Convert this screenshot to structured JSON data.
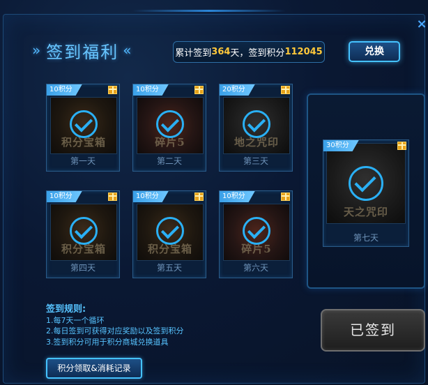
{
  "header": {
    "title": "签到福利",
    "title_deco_left": "»",
    "title_deco_right": "«",
    "stats_prefix": "累计签到",
    "total_days": "364",
    "stats_mid": "天，签到积分",
    "total_points": "112045",
    "exchange_label": "兑换",
    "close_glyph": "×"
  },
  "days": [
    {
      "label": "第一天",
      "points": "10积分",
      "item_text": "积分宝箱",
      "signed": true
    },
    {
      "label": "第二天",
      "points": "10积分",
      "item_text": "碎片5",
      "signed": true
    },
    {
      "label": "第三天",
      "points": "20积分",
      "item_text": "地之咒印",
      "signed": true
    },
    {
      "label": "第四天",
      "points": "10积分",
      "item_text": "积分宝箱",
      "signed": true
    },
    {
      "label": "第五天",
      "points": "10积分",
      "item_text": "积分宝箱",
      "signed": true
    },
    {
      "label": "第六天",
      "points": "10积分",
      "item_text": "碎片5",
      "signed": true
    },
    {
      "label": "第七天",
      "points": "30积分",
      "item_text": "天之咒印",
      "signed": true
    }
  ],
  "rules": {
    "title": "签到规则:",
    "items": [
      "1.每7天一个循环",
      "2.每日签到可获得对应奖励以及签到积分",
      "3.签到积分可用于积分商城兑换道具"
    ]
  },
  "signed_button_label": "已签到",
  "records_button_label": "积分领取&消耗记录",
  "colors": {
    "accent": "#45c2ff",
    "highlight": "#ffc83a",
    "check": "#2ab0f5"
  }
}
